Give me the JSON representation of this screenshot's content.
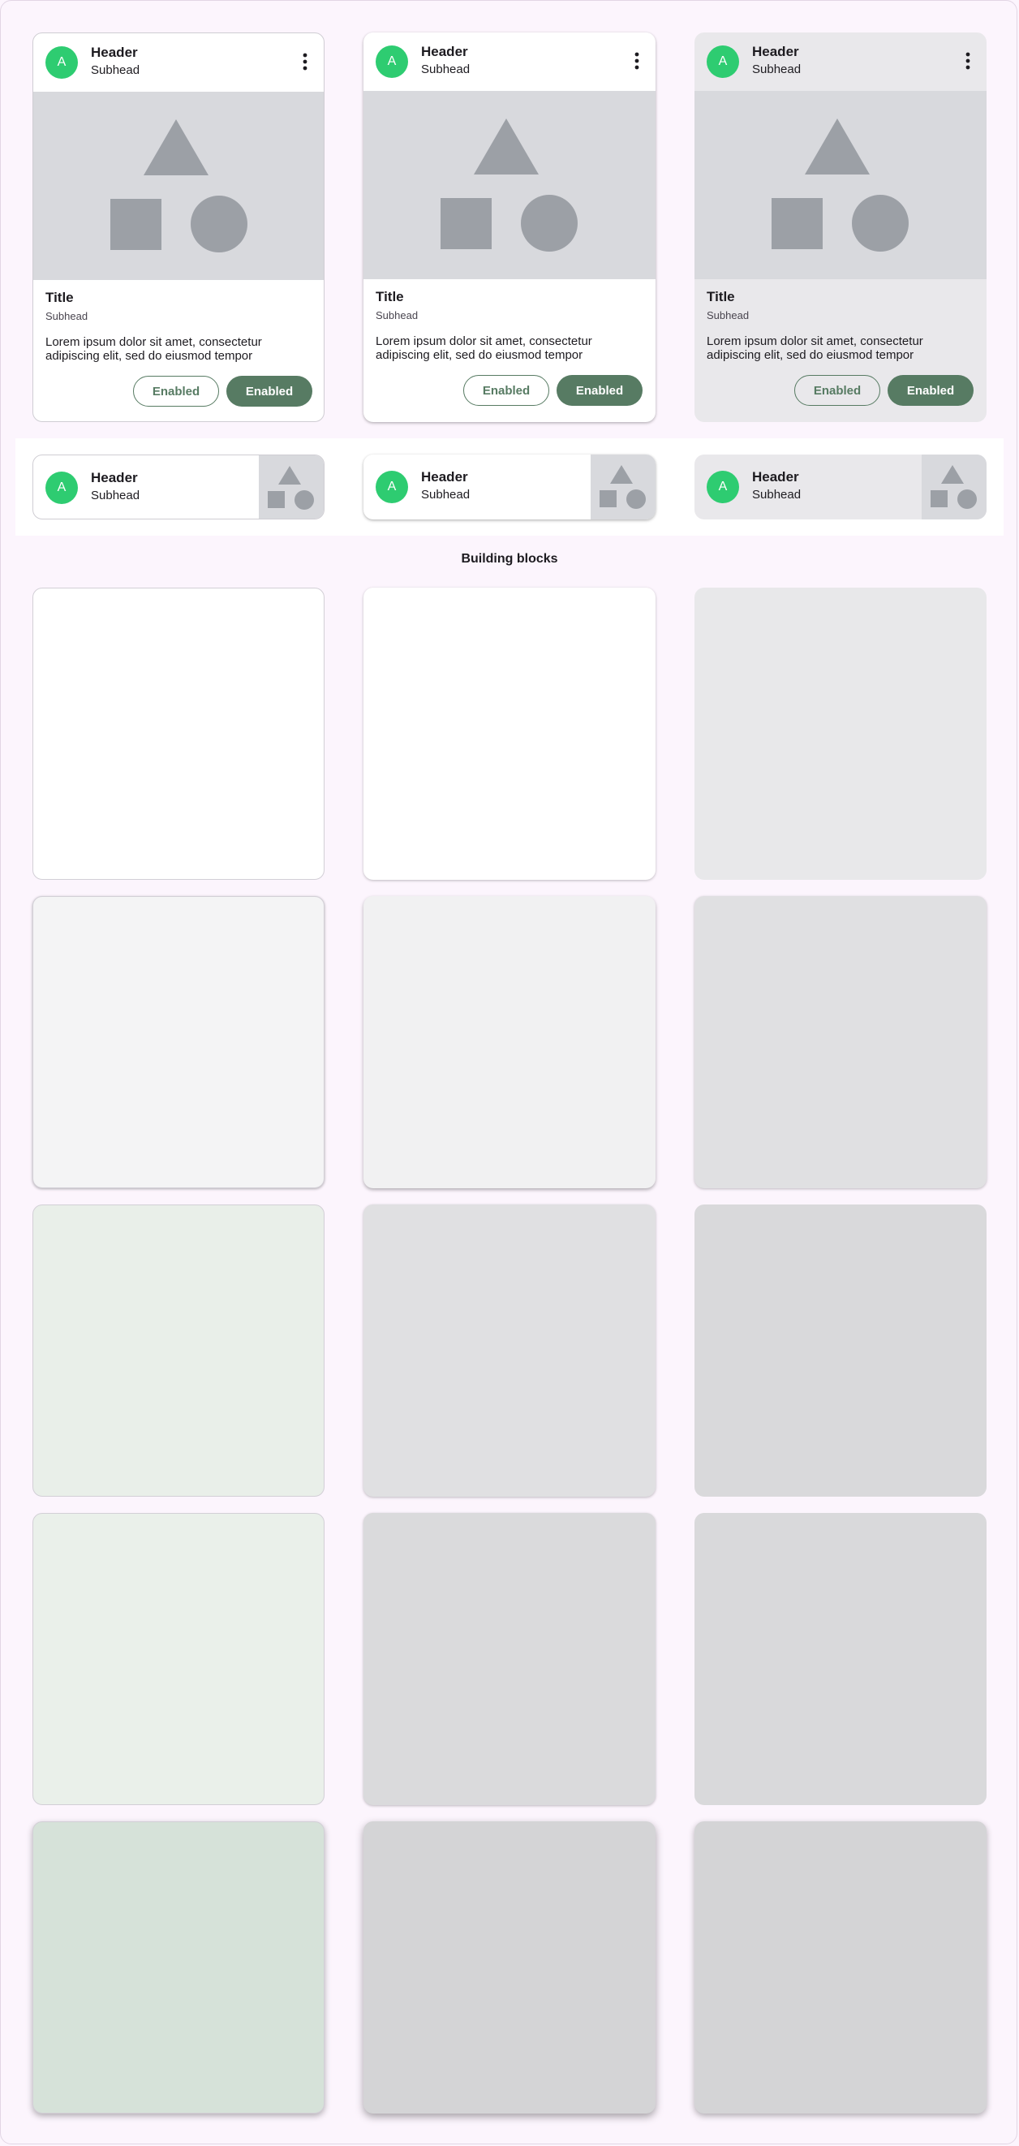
{
  "media_cards": [
    {
      "variant": "outlined",
      "header": {
        "avatar": "A",
        "title": "Header",
        "subhead": "Subhead",
        "menu_icon": "more-vert-icon"
      },
      "title": "Title",
      "subhead": "Subhead",
      "body": "Lorem ipsum dolor sit amet, consectetur adipiscing elit, sed do eiusmod tempor",
      "buttons": {
        "outlined": "Enabled",
        "filled": "Enabled"
      }
    },
    {
      "variant": "elevated",
      "header": {
        "avatar": "A",
        "title": "Header",
        "subhead": "Subhead",
        "menu_icon": "more-vert-icon"
      },
      "title": "Title",
      "subhead": "Subhead",
      "body": "Lorem ipsum dolor sit amet, consectetur adipiscing elit, sed do eiusmod tempor",
      "buttons": {
        "outlined": "Enabled",
        "filled": "Enabled"
      }
    },
    {
      "variant": "filled",
      "header": {
        "avatar": "A",
        "title": "Header",
        "subhead": "Subhead",
        "menu_icon": "more-vert-icon"
      },
      "title": "Title",
      "subhead": "Subhead",
      "body": "Lorem ipsum dolor sit amet, consectetur adipiscing elit, sed do eiusmod tempor",
      "buttons": {
        "outlined": "Enabled",
        "filled": "Enabled"
      }
    }
  ],
  "horizontal_cards": [
    {
      "variant": "outlined",
      "avatar": "A",
      "title": "Header",
      "subhead": "Subhead"
    },
    {
      "variant": "elevated",
      "avatar": "A",
      "title": "Header",
      "subhead": "Subhead"
    },
    {
      "variant": "filled",
      "avatar": "A",
      "title": "Header",
      "subhead": "Subhead"
    }
  ],
  "section_title": "Building blocks",
  "building_block_rows": [
    {
      "state": "enabled",
      "colors": [
        "#ffffff",
        "#ffffff",
        "#e8e8ea"
      ]
    },
    {
      "state": "hovered",
      "colors": [
        "#f4f4f5",
        "#f1f1f2",
        "#e0e0e2"
      ]
    },
    {
      "state": "focused",
      "colors": [
        "#e9efe9",
        "#e0e0e2",
        "#d9d9db"
      ]
    },
    {
      "state": "pressed",
      "colors": [
        "#eaf0ea",
        "#dadadc",
        "#d9d9db"
      ]
    },
    {
      "state": "dragged",
      "colors": [
        "#d6e2d9",
        "#d4d4d6",
        "#d4d4d6"
      ]
    }
  ],
  "colors": {
    "accent_green": "#577b63",
    "avatar_green": "#2ecc71",
    "media_placeholder": "#d8d9dd",
    "shape_gray": "#9ca0a6",
    "page_background": "#fcf5fd"
  }
}
